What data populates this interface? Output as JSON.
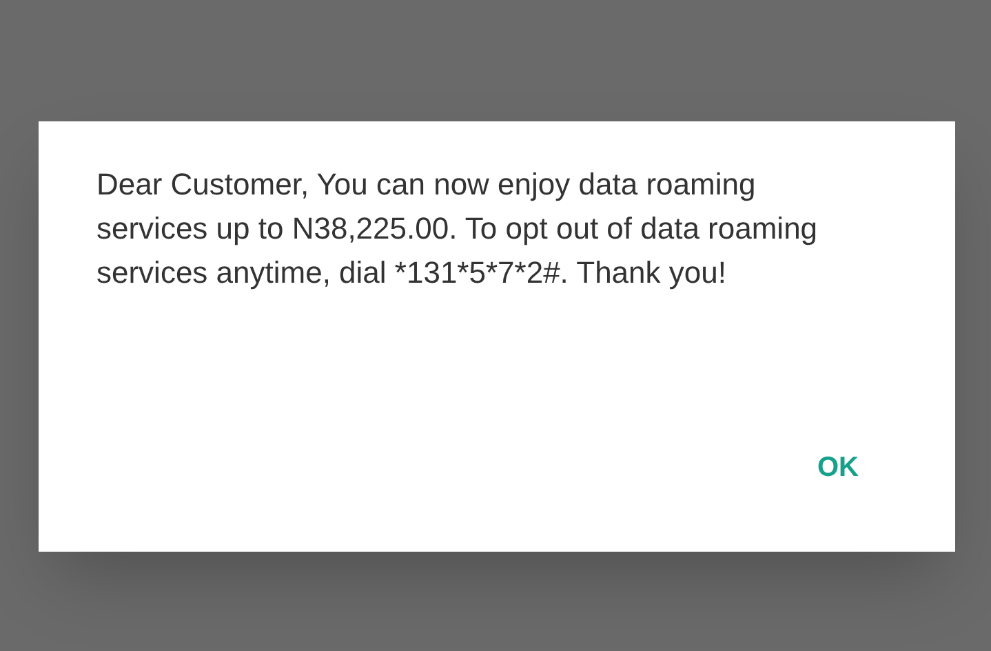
{
  "dialog": {
    "message": "Dear Customer, You can now enjoy data roaming services up to N38,225.00. To opt out of data roaming services anytime, dial *131*5*7*2#. Thank you!",
    "buttons": [
      "OK"
    ]
  }
}
